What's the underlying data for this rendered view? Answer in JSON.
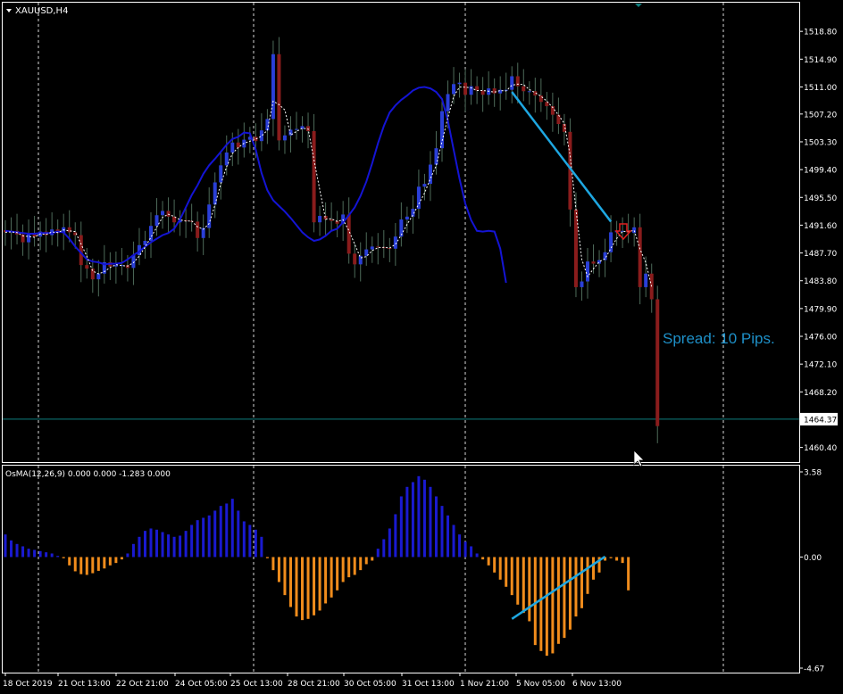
{
  "colors": {
    "background": "#000000",
    "frame": "#ffffff",
    "grid": "#ffffff",
    "bull_candle": "#2a3fd8",
    "bear_candle": "#8a1c1c",
    "wick": "#4e6b5a",
    "ma_slow": "#1414d4",
    "ma_fast": "#ffffff",
    "trendline": "#1ea7e1",
    "hline": "#0f8080",
    "osma_pos": "#1a1ad0",
    "osma_neg": "#f08c1c",
    "arrow": "#e02020",
    "spread": "#1e90c8",
    "price_tag_bg": "#ffffff",
    "price_tag_text": "#000000"
  },
  "chart_data": [
    {
      "type": "candlestick",
      "title": "XAUUSD,H4",
      "ylim": [
        1458.6,
        1520.7
      ],
      "y_ticks": [
        "1518.80",
        "1514.90",
        "1511.00",
        "1507.20",
        "1503.30",
        "1499.40",
        "1495.50",
        "1491.60",
        "1487.70",
        "1483.80",
        "1479.90",
        "1476.00",
        "1472.10",
        "1468.20",
        "1464.37",
        "1460.40"
      ],
      "x_ticks": [
        "18 Oct 2019",
        "21 Oct 13:00",
        "22 Oct 21:00",
        "24 Oct 05:00",
        "25 Oct 13:00",
        "28 Oct 21:00",
        "30 Oct 05:00",
        "31 Oct 13:00",
        "1 Nov 21:00",
        "5 Nov 05:00",
        "6 Nov 13:00"
      ],
      "closes": [
        1490.6,
        1490.8,
        1490.3,
        1489.2,
        1490.5,
        1490.0,
        1490.7,
        1490.2,
        1491.0,
        1490.5,
        1491.3,
        1490.6,
        1490.2,
        1486.0,
        1485.5,
        1484.0,
        1484.8,
        1486.4,
        1485.8,
        1486.0,
        1486.0,
        1485.6,
        1487.4,
        1488.8,
        1489.4,
        1491.5,
        1493.0,
        1493.6,
        1492.8,
        1492.0,
        1492.3,
        1492.2,
        1492.1,
        1489.8,
        1491.2,
        1494.5,
        1497.6,
        1500.0,
        1501.8,
        1503.2,
        1502.5,
        1503.6,
        1504.0,
        1503.4,
        1504.9,
        1506.5,
        1515.6,
        1503.5,
        1504.2,
        1505.0,
        1505.1,
        1505.5,
        1504.8,
        1492.0,
        1492.9,
        1492.4,
        1492.2,
        1491.8,
        1493.1,
        1487.6,
        1486.1,
        1487.3,
        1488.2,
        1488.6,
        1488.5,
        1488.4,
        1488.3,
        1490.0,
        1492.4,
        1492.8,
        1493.9,
        1497.0,
        1497.4,
        1500.1,
        1502.4,
        1507.6,
        1510.0,
        1511.4,
        1511.6,
        1509.9,
        1511.1,
        1510.5,
        1509.9,
        1510.8,
        1510.1,
        1510.6,
        1510.6,
        1512.5,
        1511.1,
        1510.4,
        1510.4,
        1509.8,
        1508.9,
        1508.3,
        1507.1,
        1505.8,
        1504.7,
        1493.8,
        1482.9,
        1483.7,
        1486.5,
        1486.2,
        1486.7,
        1487.8,
        1490.6,
        1490.8,
        1490.8,
        1490.5,
        1491.3,
        1482.9,
        1484.8,
        1481.2,
        1463.4
      ],
      "ma_slow": [
        1490.8,
        1490.7,
        1490.6,
        1490.5,
        1490.4,
        1490.4,
        1490.5,
        1490.5,
        1490.5,
        1490.7,
        1490.6,
        1489.7,
        1488.6,
        1487.7,
        1486.8,
        1486.5,
        1486.4,
        1486.1,
        1486.2,
        1486.2,
        1486.3,
        1486.8,
        1487.4,
        1487.9,
        1488.6,
        1489.2,
        1489.7,
        1490.2,
        1490.5,
        1491.1,
        1492.4,
        1494.1,
        1495.8,
        1497.2,
        1498.8,
        1500.0,
        1500.9,
        1501.9,
        1502.9,
        1503.7,
        1504.0,
        1504.6,
        1504.5,
        1502.2,
        1498.9,
        1496.5,
        1495.1,
        1494.3,
        1493.5,
        1492.6,
        1491.6,
        1490.6,
        1489.9,
        1489.4,
        1489.6,
        1490.1,
        1490.8,
        1491.1,
        1492.0,
        1493.0,
        1494.1,
        1495.7,
        1497.7,
        1500.3,
        1503.1,
        1505.5,
        1507.4,
        1508.4,
        1509.2,
        1509.8,
        1510.5,
        1510.9,
        1511.0,
        1510.8,
        1510.3,
        1509.3,
        1506.3,
        1502.2,
        1498.1,
        1494.6,
        1492.3,
        1490.8,
        1490.7,
        1490.8,
        1490.7,
        1488.3,
        1483.5
      ]
    },
    {
      "type": "bar",
      "title": "OsMA(12,26,9) 0.000 0.000 -1.283 0.000",
      "ylim": [
        -4.67,
        3.58
      ],
      "y_ticks": [
        "3.58",
        "0.00",
        "-4.67"
      ],
      "values": [
        0.95,
        0.7,
        0.55,
        0.45,
        0.35,
        0.3,
        0.25,
        0.2,
        0.15,
        0.05,
        -0.05,
        -0.35,
        -0.6,
        -0.72,
        -0.75,
        -0.68,
        -0.58,
        -0.48,
        -0.35,
        -0.25,
        -0.1,
        0.15,
        0.55,
        0.85,
        1.1,
        1.2,
        1.15,
        1.05,
        0.95,
        0.85,
        0.9,
        1.1,
        1.35,
        1.55,
        1.65,
        1.75,
        1.95,
        2.15,
        2.25,
        2.45,
        1.95,
        1.5,
        1.35,
        1.15,
        0.85,
        -0.05,
        -0.55,
        -1.05,
        -1.6,
        -2.1,
        -2.5,
        -2.65,
        -2.6,
        -2.45,
        -2.25,
        -1.95,
        -1.7,
        -1.4,
        -1.05,
        -0.85,
        -0.75,
        -0.55,
        -0.3,
        -0.15,
        0.35,
        0.75,
        1.2,
        1.8,
        2.55,
        2.95,
        3.15,
        3.4,
        3.25,
        2.95,
        2.55,
        2.15,
        1.75,
        1.35,
        0.95,
        0.65,
        0.45,
        0.15,
        -0.1,
        -0.35,
        -0.65,
        -0.95,
        -1.25,
        -1.6,
        -2.0,
        -2.35,
        -2.7,
        -3.7,
        -3.95,
        -4.15,
        -4.05,
        -3.65,
        -3.4,
        -3.05,
        -2.5,
        -2.15,
        -1.55,
        -0.95,
        -0.65,
        -0.15,
        -0.05,
        -0.15,
        -0.25,
        -1.4
      ]
    }
  ],
  "annotations": {
    "spread_text": "Spread: 10 Pips.",
    "current_price": "1464.37"
  }
}
